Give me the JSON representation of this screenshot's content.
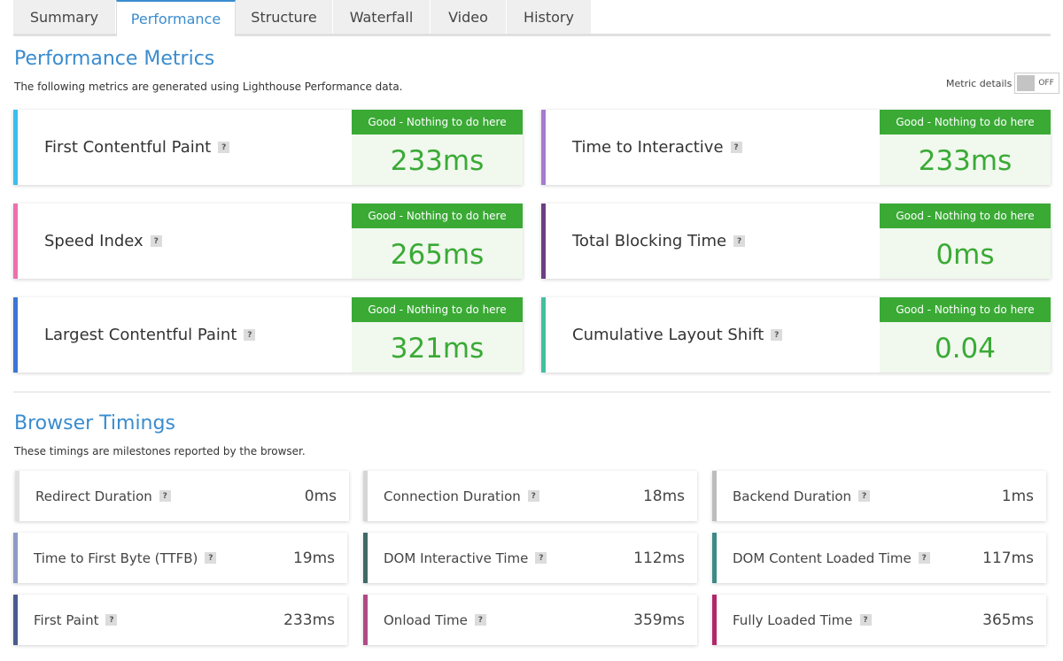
{
  "tabs": [
    "Summary",
    "Performance",
    "Structure",
    "Waterfall",
    "Video",
    "History"
  ],
  "performance": {
    "title": "Performance Metrics",
    "description": "The following metrics are generated using Lighthouse Performance data.",
    "toggle": {
      "label": "Metric details",
      "state": "OFF"
    },
    "badge_text": "Good - Nothing to do here",
    "help": "?",
    "metrics": [
      {
        "name": "First Contentful Paint",
        "value": "233ms",
        "color": "#3cbfee"
      },
      {
        "name": "Time to Interactive",
        "value": "233ms",
        "color": "#a77bcf"
      },
      {
        "name": "Speed Index",
        "value": "265ms",
        "color": "#ee70ae"
      },
      {
        "name": "Total Blocking Time",
        "value": "0ms",
        "color": "#6d3e84"
      },
      {
        "name": "Largest Contentful Paint",
        "value": "321ms",
        "color": "#3a76d6"
      },
      {
        "name": "Cumulative Layout Shift",
        "value": "0.04",
        "color": "#43bfa0"
      }
    ]
  },
  "browser": {
    "title": "Browser Timings",
    "description": "These timings are milestones reported by the browser.",
    "timings": [
      {
        "name": "Redirect Duration",
        "value": "0ms",
        "color": "#e0e0e0"
      },
      {
        "name": "Connection Duration",
        "value": "18ms",
        "color": "#d6d6d6"
      },
      {
        "name": "Backend Duration",
        "value": "1ms",
        "color": "#bcbcbc"
      },
      {
        "name": "Time to First Byte (TTFB)",
        "value": "19ms",
        "color": "#8f9ac6"
      },
      {
        "name": "DOM Interactive Time",
        "value": "112ms",
        "color": "#3f6a66"
      },
      {
        "name": "DOM Content Loaded Time",
        "value": "117ms",
        "color": "#3d8a86"
      },
      {
        "name": "First Paint",
        "value": "233ms",
        "color": "#4a5b8f"
      },
      {
        "name": "Onload Time",
        "value": "359ms",
        "color": "#b04a86"
      },
      {
        "name": "Fully Loaded Time",
        "value": "365ms",
        "color": "#b0286a"
      }
    ]
  }
}
